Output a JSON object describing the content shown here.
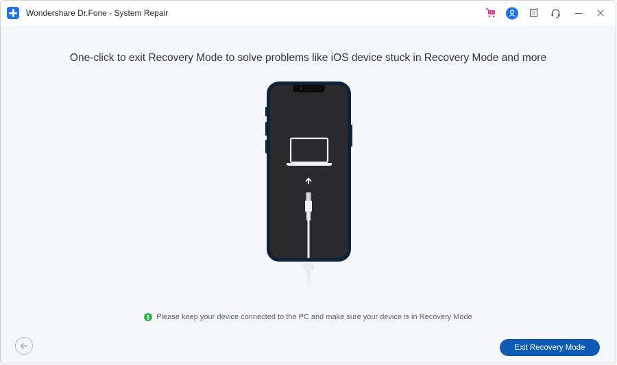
{
  "window": {
    "title": "Wondershare Dr.Fone - System Repair",
    "icons": [
      "cart-icon",
      "user-icon",
      "feedback-icon",
      "support-headset-icon",
      "minimize-icon",
      "close-icon"
    ]
  },
  "main": {
    "heading": "One-click to exit Recovery Mode to solve problems like iOS device stuck in Recovery Mode and more",
    "illustration": "iphone-recovery-mode-connect-to-computer",
    "notice": "Please keep your device connected to the PC and make sure your device is in Recovery Mode"
  },
  "footer": {
    "back_label": "Back",
    "exit_button_label": "Exit Recovery Mode"
  },
  "colors": {
    "accent": "#0e5bb5",
    "logo": "#1a73e8",
    "notice_ok": "#2fb344",
    "cart": "#e8308a"
  }
}
